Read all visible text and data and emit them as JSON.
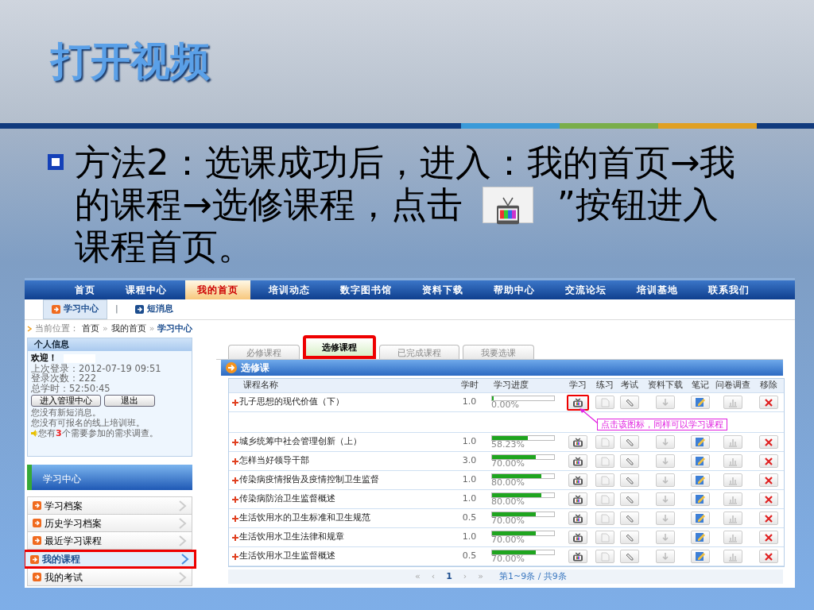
{
  "slide": {
    "title": "打开视频",
    "bullet": {
      "lines": [
        {
          "parts": [
            "方法2：选课成功后，进入：我的首页→我"
          ]
        },
        {
          "parts": [
            "的课程→选修课程，点击",
            "”按钮进入"
          ]
        },
        {
          "parts": [
            "课程首页。"
          ]
        }
      ]
    }
  },
  "site": {
    "nav": [
      {
        "label": "首页",
        "selected": false
      },
      {
        "label": "课程中心",
        "selected": false
      },
      {
        "label": "我的首页",
        "selected": true
      },
      {
        "label": "培训动态",
        "selected": false
      },
      {
        "label": "数字图书馆",
        "selected": false
      },
      {
        "label": "资料下载",
        "selected": false
      },
      {
        "label": "帮助中心",
        "selected": false
      },
      {
        "label": "交流论坛",
        "selected": false
      },
      {
        "label": "培训基地",
        "selected": false
      },
      {
        "label": "联系我们",
        "selected": false
      }
    ],
    "subnav": [
      {
        "label": "学习中心",
        "selected": true
      },
      {
        "label": "短消息",
        "selected": false
      }
    ],
    "subnav_separator": "|",
    "breadcrumb": [
      {
        "text": "当前位置：",
        "kind": "label"
      },
      {
        "text": "首页",
        "kind": "link"
      },
      {
        "text": "»",
        "kind": "sep"
      },
      {
        "text": "我的首页",
        "kind": "link"
      },
      {
        "text": "»",
        "kind": "sep"
      },
      {
        "text": "学习中心",
        "kind": "current"
      }
    ],
    "personal_info": {
      "title": "个人信息",
      "welcome": "欢迎！",
      "lines": [
        "上次登录：2012-07-19 09:51",
        "登录次数：222",
        "总学时：52:50:45"
      ],
      "buttons": [
        "进入管理中心",
        "退出"
      ],
      "messages": [
        {
          "text": "您没有新短消息。",
          "kind": "plain"
        },
        {
          "text": "您没有可报名的线上培训班。",
          "kind": "plain"
        },
        {
          "text": "您有**3**个需要参加的需求调查。",
          "kind": "alert"
        }
      ]
    },
    "study_center": {
      "title": "学习中心",
      "items": [
        {
          "label": "学习档案",
          "selected": false,
          "highlighted": false
        },
        {
          "label": "历史学习档案",
          "selected": false,
          "highlighted": false
        },
        {
          "label": "最近学习课程",
          "selected": false,
          "highlighted": false
        },
        {
          "label": "我的课程",
          "selected": true,
          "highlighted": true
        },
        {
          "label": "我的考试",
          "selected": false,
          "highlighted": false
        }
      ]
    },
    "tabs": [
      {
        "label": "必修课程",
        "selected": false,
        "highlighted": false
      },
      {
        "label": "选修课程",
        "selected": true,
        "highlighted": true
      },
      {
        "label": "已完成课程",
        "selected": false,
        "highlighted": false
      },
      {
        "label": "我要选课",
        "selected": false,
        "highlighted": false
      }
    ],
    "panel_title": "选修课",
    "table": {
      "columns": [
        "课程名称",
        "学时",
        "学习进度",
        "学习",
        "练习",
        "考试",
        "资料下载",
        "笔记",
        "问卷调查",
        "移除"
      ],
      "rows": [
        {
          "name": "孔子思想的现代价值（下）",
          "hours": "1.0",
          "level": 0,
          "progress": "0.00%",
          "learn_highlighted": true,
          "callout": "点击该图标，同样可以学习课程"
        },
        {
          "name": "城乡统筹中社会管理创新（上）",
          "hours": "1.0",
          "level": 0.5823,
          "progress": "58.23%",
          "learn_highlighted": false
        },
        {
          "name": "怎样当好领导干部",
          "hours": "3.0",
          "level": 0.7,
          "progress": "70.00%",
          "learn_highlighted": false
        },
        {
          "name": "传染病疫情报告及疫情控制卫生监督",
          "hours": "1.0",
          "level": 0.8,
          "progress": "80.00%",
          "learn_highlighted": false
        },
        {
          "name": "传染病防治卫生监督概述",
          "hours": "1.0",
          "level": 0.8,
          "progress": "80.00%",
          "learn_highlighted": false
        },
        {
          "name": "生活饮用水的卫生标准和卫生规范",
          "hours": "0.5",
          "level": 0.7,
          "progress": "70.00%",
          "learn_highlighted": false
        },
        {
          "name": "生活饮用水卫生法律和规章",
          "hours": "1.0",
          "level": 0.7,
          "progress": "70.00%",
          "learn_highlighted": false
        },
        {
          "name": "生活饮用水卫生监督概述",
          "hours": "0.5",
          "level": 0.7,
          "progress": "70.00%",
          "learn_highlighted": false
        }
      ]
    },
    "pager": {
      "controls": [
        {
          "label": "«",
          "selected": false
        },
        {
          "label": "‹",
          "selected": false
        },
        {
          "label": "1",
          "selected": true
        },
        {
          "label": "›",
          "selected": false
        },
        {
          "label": "»",
          "selected": false
        }
      ],
      "summary": "第1~9条 / 共9条"
    }
  }
}
